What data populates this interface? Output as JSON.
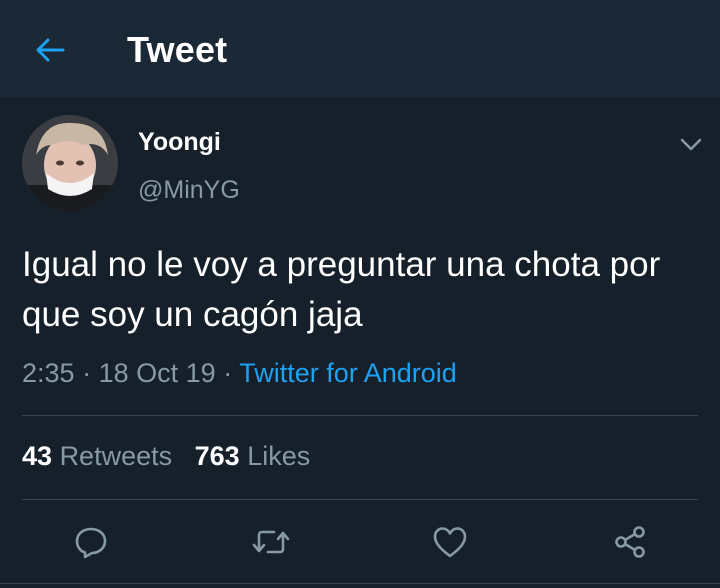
{
  "header": {
    "title": "Tweet",
    "back_icon": "arrow-left-icon"
  },
  "tweet": {
    "author": {
      "display_name": "Yoongi",
      "handle": "@MinYG"
    },
    "text": "Igual no le voy a preguntar una chota por que soy un cagón jaja",
    "time": "2:35",
    "date": "18 Oct 19",
    "separator": "·",
    "source": "Twitter for Android",
    "retweets_count": "43",
    "retweets_label": "Retweets",
    "likes_count": "763",
    "likes_label": "Likes"
  },
  "actions": [
    "reply-icon",
    "retweet-icon",
    "like-icon",
    "share-icon"
  ],
  "colors": {
    "background": "#15202b",
    "header": "#1b2836",
    "accent": "#1da1f2",
    "secondary_text": "#8899a6",
    "divider": "#38444d"
  }
}
